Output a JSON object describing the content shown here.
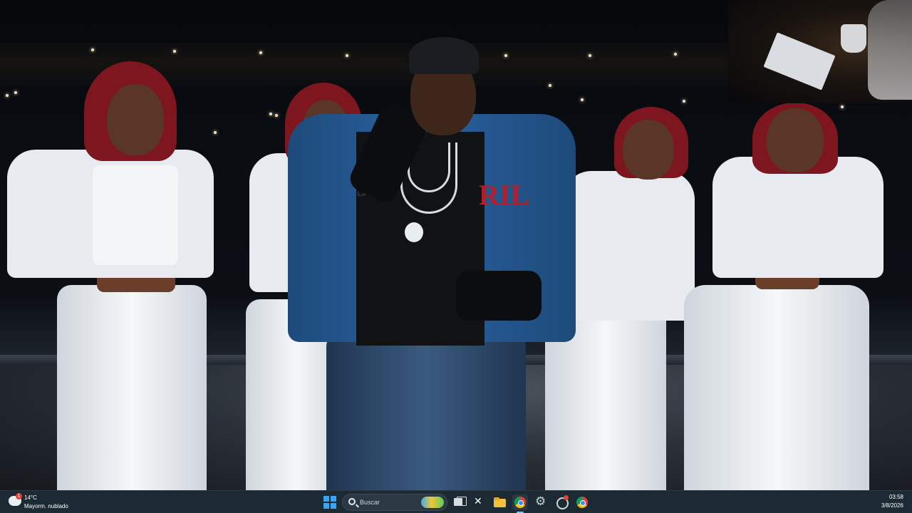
{
  "taskbar": {
    "weather": {
      "temperature": "14°C",
      "description": "Mayorm. nublado",
      "badge": "1",
      "icon": "cloud-weather-icon"
    },
    "search": {
      "placeholder": "Buscar",
      "icon": "search-icon"
    },
    "apps": [
      {
        "name": "start",
        "icon": "windows-start-icon"
      },
      {
        "name": "task-view",
        "icon": "task-view-icon"
      },
      {
        "name": "capcut",
        "icon": "capcut-icon"
      },
      {
        "name": "file-explorer",
        "icon": "folder-icon"
      },
      {
        "name": "chrome",
        "icon": "chrome-icon",
        "active": true
      },
      {
        "name": "settings",
        "icon": "gear-icon"
      },
      {
        "name": "clock",
        "icon": "clock-icon"
      },
      {
        "name": "chrome-profile",
        "icon": "chrome-icon"
      }
    ],
    "clock": {
      "time": "03:58",
      "date": "3/8/2026"
    }
  },
  "colors": {
    "taskbar_bg": "#1c2a33",
    "accent": "#3aa6f0"
  }
}
